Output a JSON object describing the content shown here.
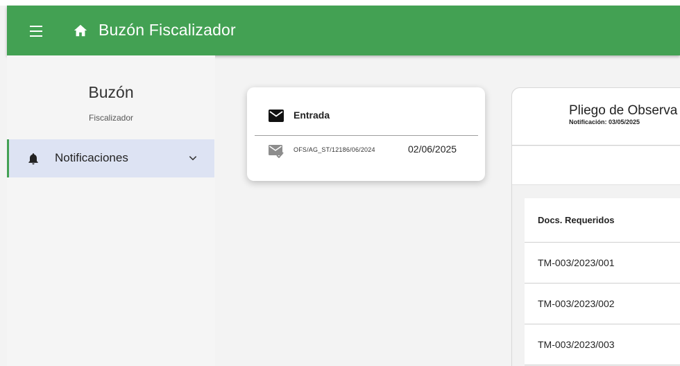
{
  "appbar": {
    "title": "Buzón Fiscalizador",
    "menu_icon": "menu-icon",
    "home_icon": "home-icon",
    "color": "#43a153"
  },
  "sidebar": {
    "title": "Buzón",
    "subtitle": "Fiscalizador",
    "items": [
      {
        "label": "Notificaciones",
        "icon": "bell-icon",
        "expand_icon": "chevron-down-icon",
        "active": true
      }
    ]
  },
  "inbox": {
    "title": "Entrada",
    "icon": "mail-icon",
    "messages": [
      {
        "code": "OFS/AG_ST/12186/06/2024",
        "date": "02/06/2025",
        "icon": "mail-read-icon"
      }
    ]
  },
  "detail": {
    "title": "Pliego de Observa",
    "subtitle": "Notificación: 03/05/2025",
    "table": {
      "header": "Docs. Requeridos",
      "rows": [
        "TM-003/2023/001",
        "TM-003/2023/002",
        "TM-003/2023/003"
      ]
    }
  },
  "colors": {
    "primary": "#43a153",
    "nav_active_bg": "#dde3f3"
  }
}
